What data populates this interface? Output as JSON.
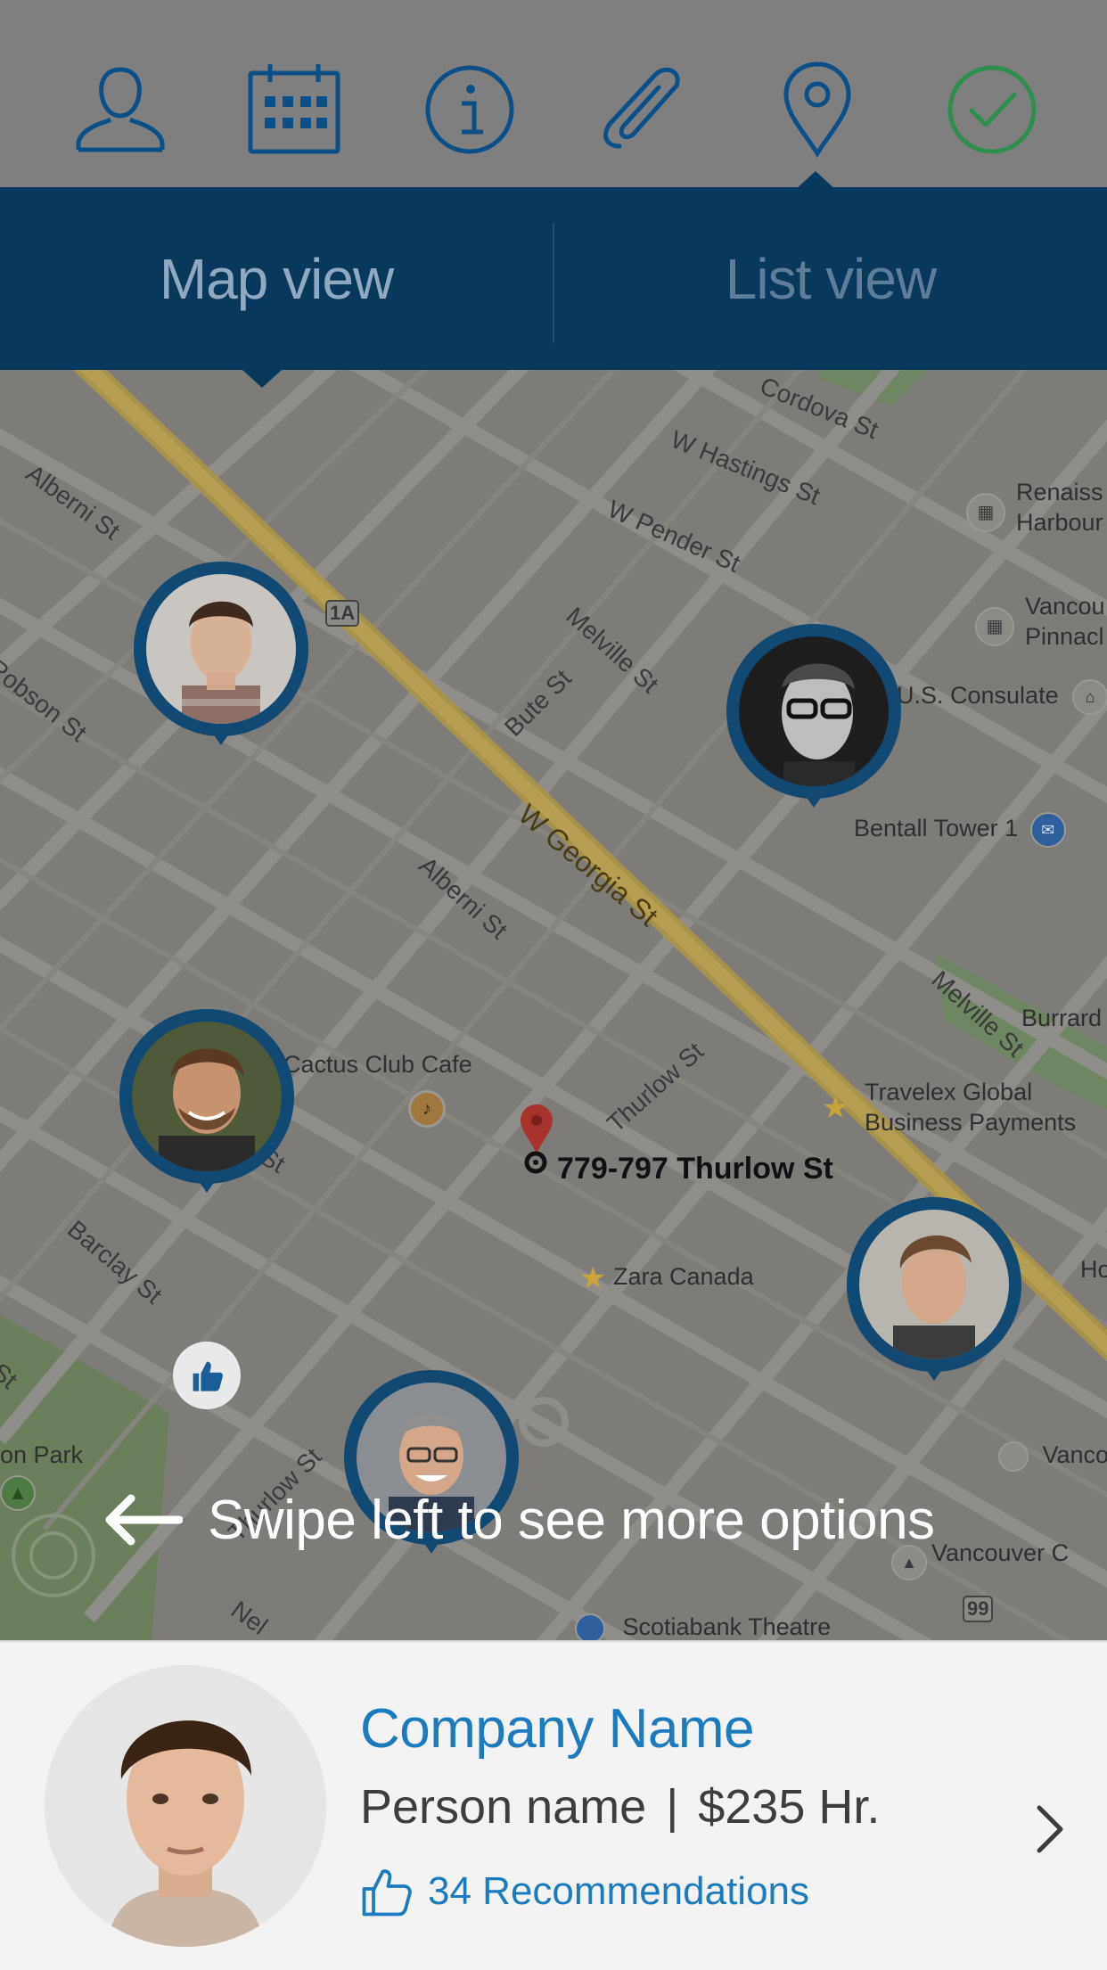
{
  "toolbar": {
    "icons": [
      "user-icon",
      "calendar-icon",
      "info-icon",
      "paperclip-icon",
      "location-pin-icon",
      "checkmark-icon"
    ],
    "active_icon": "location-pin-icon",
    "icon_color": "#0b4f86",
    "check_color": "#2f8f4e"
  },
  "tabs": {
    "map_label": "Map view",
    "list_label": "List view",
    "selected": "Map view",
    "bar_color": "#06395b"
  },
  "map": {
    "streets": [
      "Alberni St",
      "Robson St",
      "W Hastings St",
      "W Pender St",
      "Melville St",
      "Bute St",
      "W Georgia St",
      "Alberni St",
      "Thurlow St",
      "Melville St",
      "Barclay St",
      "Thurlow St",
      "Burrard St",
      "Cordova St",
      "o St",
      "St",
      "Nel",
      "1A",
      "99"
    ],
    "pois": {
      "renaissance": "Renaiss Harbour",
      "vancouver_pinnacle": "Vancou Pinnacl",
      "us_consulate": "U.S. Consulate",
      "bentall": "Bentall Tower 1",
      "burrard": "Burrard",
      "cactus": "Cactus Club Cafe",
      "travelex": "Travelex Global Business Payments",
      "zara": "Zara Canada",
      "nelson_park": "on Park",
      "vancouver_bottom": "Vancouver C",
      "vancou_right": "Vancou",
      "scotiabank": "Scotiabank Theatre",
      "ho": "Ho"
    },
    "address": "779-797 Thurlow St",
    "markers": 5,
    "liked_marker_icon": "thumbs-up-icon"
  },
  "swipe_hint": {
    "text": "Swipe left to see more options",
    "icon": "arrow-left-icon"
  },
  "card": {
    "company": "Company Name",
    "person": "Person name",
    "separator": "|",
    "rate": "$235 Hr.",
    "recommendations": "34 Recommendations",
    "recommend_icon": "thumbs-up-outline-icon",
    "chevron_icon": "chevron-right-icon",
    "accent": "#1b7bbf"
  }
}
